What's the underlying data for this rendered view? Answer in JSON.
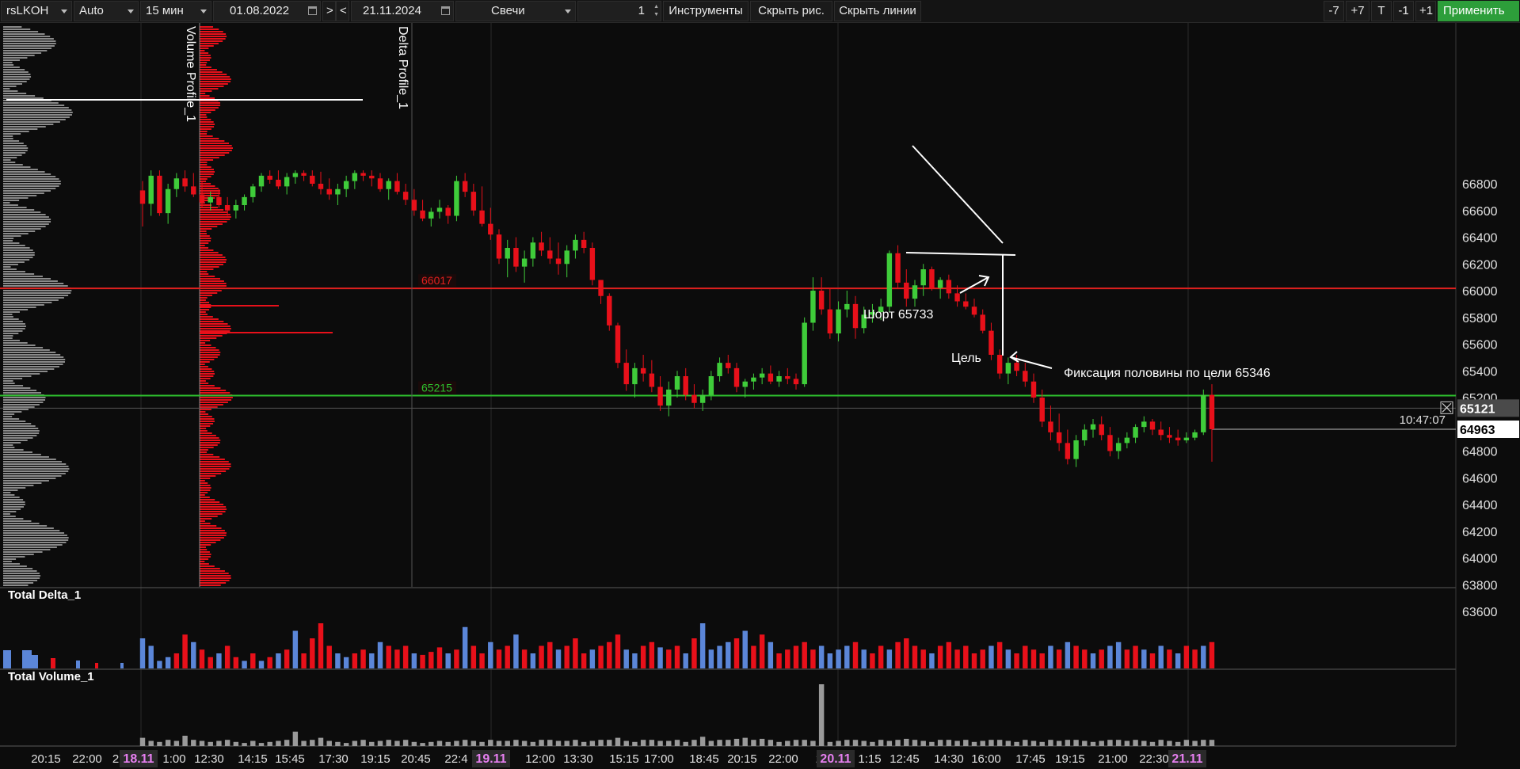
{
  "toolbar": {
    "symbol": "rsLKOH",
    "scale": "Auto",
    "timeframe": "15 мин",
    "date_from": "01.08.2022",
    "nav_next": ">",
    "nav_prev": "<",
    "date_to": "21.11.2024",
    "chart_type": "Свечи",
    "count": "1",
    "instruments": "Инструменты",
    "hide_drawings": "Скрыть рис.",
    "hide_lines": "Скрыть линии",
    "minus7": "-7",
    "plus7": "+7",
    "t": "T",
    "minus1": "-1",
    "plus1": "+1",
    "apply": "Применить"
  },
  "colors": {
    "up": "#3fcc3a",
    "down": "#e8101a",
    "delta_pos": "#5b86d8",
    "delta_neg": "#e8101a",
    "volume": "#9a9a9a",
    "level_red": "#e0201e",
    "level_green": "#2ec02e",
    "accent_date": "#e67ff0",
    "apply": "#2d9e3a"
  },
  "chart_data": {
    "type": "candlestick",
    "symbol": "rsLKOH",
    "price_axis": {
      "min": 63500,
      "max": 66900,
      "ticks": [
        63600,
        63800,
        64000,
        64200,
        64400,
        64600,
        64800,
        65000,
        65200,
        65400,
        65600,
        65800,
        66000,
        66200,
        66400,
        66600,
        66800
      ]
    },
    "levels": [
      {
        "price": 66017,
        "label": "66017",
        "color": "#e0201e"
      },
      {
        "price": 65215,
        "label": "65215",
        "color": "#2ec02e"
      }
    ],
    "crosshair": {
      "price": 65121,
      "label": "65121"
    },
    "last_price": {
      "price": 64963,
      "label": "64963",
      "time": "10:47:07"
    },
    "time_labels": [
      {
        "text": "20:15"
      },
      {
        "text": "22:00"
      },
      {
        "text": "2"
      },
      {
        "text": "18.11",
        "day": true
      },
      {
        "text": "1:00"
      },
      {
        "text": "12:30"
      },
      {
        "text": "14:15"
      },
      {
        "text": "15:45"
      },
      {
        "text": "17:30"
      },
      {
        "text": "19:15"
      },
      {
        "text": "20:45"
      },
      {
        "text": "22:4"
      },
      {
        "text": "19.11",
        "day": true
      },
      {
        "text": "12:00"
      },
      {
        "text": "13:30"
      },
      {
        "text": "15:15"
      },
      {
        "text": "17:00"
      },
      {
        "text": "18:45"
      },
      {
        "text": "20:15"
      },
      {
        "text": "22:00"
      },
      {
        "text": "2"
      },
      {
        "text": "20.11",
        "day": true
      },
      {
        "text": "1:15"
      },
      {
        "text": "12:45"
      },
      {
        "text": "14:30"
      },
      {
        "text": "16:00"
      },
      {
        "text": "17:45"
      },
      {
        "text": "19:15"
      },
      {
        "text": "21:00"
      },
      {
        "text": "22:30"
      },
      {
        "text": "21.11",
        "day": true
      }
    ],
    "candles": [
      [
        66750,
        66820,
        66480,
        66650
      ],
      [
        66650,
        66900,
        66560,
        66860
      ],
      [
        66860,
        66900,
        66560,
        66580
      ],
      [
        66580,
        66800,
        66500,
        66760
      ],
      [
        66760,
        66880,
        66700,
        66840
      ],
      [
        66840,
        66900,
        66740,
        66780
      ],
      [
        66780,
        66880,
        66700,
        66720
      ],
      [
        66720,
        66820,
        66620,
        66660
      ],
      [
        66660,
        66740,
        66600,
        66700
      ],
      [
        66700,
        66760,
        66620,
        66640
      ],
      [
        66640,
        66700,
        66560,
        66600
      ],
      [
        66600,
        66680,
        66540,
        66640
      ],
      [
        66640,
        66720,
        66600,
        66700
      ],
      [
        66700,
        66800,
        66660,
        66780
      ],
      [
        66780,
        66880,
        66740,
        66860
      ],
      [
        66860,
        66900,
        66800,
        66830
      ],
      [
        66830,
        66900,
        66760,
        66780
      ],
      [
        66780,
        66880,
        66720,
        66850
      ],
      [
        66850,
        66900,
        66800,
        66880
      ],
      [
        66880,
        66900,
        66820,
        66860
      ],
      [
        66860,
        66900,
        66780,
        66800
      ],
      [
        66800,
        66890,
        66720,
        66760
      ],
      [
        66760,
        66840,
        66680,
        66720
      ],
      [
        66720,
        66800,
        66640,
        66760
      ],
      [
        66760,
        66860,
        66700,
        66820
      ],
      [
        66820,
        66900,
        66760,
        66880
      ],
      [
        66880,
        66900,
        66820,
        66860
      ],
      [
        66860,
        66900,
        66780,
        66840
      ],
      [
        66840,
        66880,
        66740,
        66760
      ],
      [
        66760,
        66840,
        66680,
        66820
      ],
      [
        66820,
        66880,
        66720,
        66740
      ],
      [
        66740,
        66800,
        66640,
        66680
      ],
      [
        66680,
        66760,
        66560,
        66600
      ],
      [
        66600,
        66680,
        66520,
        66540
      ],
      [
        66540,
        66620,
        66480,
        66590
      ],
      [
        66590,
        66680,
        66540,
        66620
      ],
      [
        66620,
        66640,
        66500,
        66560
      ],
      [
        66560,
        66860,
        66520,
        66820
      ],
      [
        66820,
        66880,
        66700,
        66740
      ],
      [
        66740,
        66800,
        66560,
        66600
      ],
      [
        66600,
        66780,
        66480,
        66500
      ],
      [
        66500,
        66620,
        66380,
        66420
      ],
      [
        66420,
        66460,
        66200,
        66240
      ],
      [
        66240,
        66380,
        66100,
        66320
      ],
      [
        66320,
        66400,
        66140,
        66180
      ],
      [
        66180,
        66300,
        66060,
        66240
      ],
      [
        66240,
        66400,
        66180,
        66360
      ],
      [
        66360,
        66440,
        66260,
        66300
      ],
      [
        66300,
        66400,
        66200,
        66240
      ],
      [
        66240,
        66360,
        66120,
        66200
      ],
      [
        66200,
        66340,
        66100,
        66300
      ],
      [
        66300,
        66420,
        66240,
        66380
      ],
      [
        66380,
        66440,
        66280,
        66320
      ],
      [
        66320,
        66360,
        66040,
        66080
      ],
      [
        66080,
        66020,
        65900,
        65960
      ],
      [
        65960,
        65980,
        65700,
        65740
      ],
      [
        65740,
        65760,
        65420,
        65460
      ],
      [
        65460,
        65560,
        65250,
        65300
      ],
      [
        65300,
        65460,
        65200,
        65420
      ],
      [
        65420,
        65520,
        65320,
        65380
      ],
      [
        65380,
        65480,
        65240,
        65280
      ],
      [
        65280,
        65360,
        65100,
        65140
      ],
      [
        65140,
        65320,
        65060,
        65260
      ],
      [
        65260,
        65400,
        65200,
        65360
      ],
      [
        65360,
        65420,
        65180,
        65220
      ],
      [
        65220,
        65300,
        65120,
        65160
      ],
      [
        65160,
        65260,
        65100,
        65220
      ],
      [
        65220,
        65400,
        65180,
        65360
      ],
      [
        65360,
        65500,
        65320,
        65460
      ],
      [
        65460,
        65520,
        65380,
        65420
      ],
      [
        65420,
        65460,
        65240,
        65280
      ],
      [
        65280,
        65340,
        65200,
        65320
      ],
      [
        65320,
        65380,
        65260,
        65350
      ],
      [
        65350,
        65420,
        65300,
        65380
      ],
      [
        65380,
        65440,
        65300,
        65320
      ],
      [
        65320,
        65400,
        65280,
        65360
      ],
      [
        65360,
        65420,
        65300,
        65340
      ],
      [
        65340,
        65380,
        65260,
        65300
      ],
      [
        65300,
        65800,
        65280,
        65760
      ],
      [
        65760,
        66100,
        65700,
        66000
      ],
      [
        66000,
        66100,
        65820,
        65860
      ],
      [
        65860,
        66020,
        65640,
        65680
      ],
      [
        65680,
        65920,
        65620,
        65860
      ],
      [
        65860,
        66000,
        65800,
        65900
      ],
      [
        65900,
        65960,
        65640,
        65720
      ],
      [
        65720,
        65880,
        65680,
        65820
      ],
      [
        65820,
        65900,
        65760,
        65840
      ],
      [
        65840,
        65940,
        65780,
        65880
      ],
      [
        65880,
        66300,
        65840,
        66280
      ],
      [
        66280,
        66340,
        66020,
        66060
      ],
      [
        66060,
        66160,
        65880,
        65940
      ],
      [
        65940,
        66080,
        65880,
        66040
      ],
      [
        66040,
        66200,
        65960,
        66160
      ],
      [
        66160,
        66180,
        66000,
        66020
      ],
      [
        66020,
        66100,
        65940,
        66080
      ],
      [
        66080,
        66120,
        65940,
        65980
      ],
      [
        65980,
        66040,
        65880,
        65920
      ],
      [
        65920,
        65980,
        65860,
        65880
      ],
      [
        65880,
        65940,
        65800,
        65820
      ],
      [
        65820,
        65860,
        65680,
        65700
      ],
      [
        65700,
        65760,
        65480,
        65520
      ],
      [
        65520,
        65560,
        65340,
        65380
      ],
      [
        65380,
        65500,
        65300,
        65460
      ],
      [
        65460,
        65520,
        65360,
        65400
      ],
      [
        65400,
        65460,
        65280,
        65320
      ],
      [
        65320,
        65380,
        65160,
        65200
      ],
      [
        65200,
        65260,
        64980,
        65020
      ],
      [
        65020,
        65140,
        64880,
        64940
      ],
      [
        64940,
        65080,
        64800,
        64860
      ],
      [
        64860,
        64960,
        64700,
        64740
      ],
      [
        64740,
        64920,
        64680,
        64880
      ],
      [
        64880,
        65000,
        64840,
        64960
      ],
      [
        64960,
        65040,
        64900,
        65000
      ],
      [
        65000,
        65060,
        64880,
        64920
      ],
      [
        64920,
        64980,
        64760,
        64800
      ],
      [
        64800,
        64900,
        64740,
        64860
      ],
      [
        64860,
        64940,
        64820,
        64900
      ],
      [
        64900,
        65000,
        64860,
        64980
      ],
      [
        64980,
        65060,
        64940,
        65020
      ],
      [
        65020,
        65040,
        64920,
        64960
      ],
      [
        64960,
        65020,
        64880,
        64920
      ],
      [
        64920,
        64980,
        64860,
        64900
      ],
      [
        64900,
        64960,
        64840,
        64880
      ],
      [
        64880,
        64940,
        64860,
        64900
      ],
      [
        64900,
        64960,
        64880,
        64940
      ],
      [
        64940,
        65260,
        64920,
        65220
      ],
      [
        65220,
        65300,
        64720,
        64963
      ]
    ],
    "annotations": [
      {
        "text": "Шорт 65733"
      },
      {
        "text": "Цель"
      },
      {
        "text": "Фиксация половины по цели 65346"
      }
    ],
    "indicators": [
      {
        "name": "Volume Profile_1"
      },
      {
        "name": "Delta Profile_1"
      },
      {
        "name": "Total Delta_1"
      },
      {
        "name": "Total Volume_1"
      }
    ],
    "delta": [
      40,
      30,
      10,
      15,
      20,
      45,
      35,
      25,
      15,
      20,
      30,
      15,
      10,
      20,
      10,
      15,
      20,
      25,
      50,
      20,
      40,
      60,
      30,
      20,
      15,
      20,
      25,
      20,
      35,
      30,
      25,
      30,
      20,
      18,
      22,
      28,
      20,
      25,
      55,
      30,
      20,
      35,
      25,
      30,
      45,
      25,
      20,
      30,
      35,
      25,
      30,
      40,
      20,
      25,
      30,
      35,
      45,
      25,
      20,
      30,
      35,
      28,
      25,
      30,
      20,
      40,
      60,
      25,
      30,
      35,
      40,
      50,
      30,
      45,
      35,
      20,
      25,
      30,
      35,
      25,
      30,
      20,
      25,
      30,
      35,
      25,
      20,
      30,
      25,
      35,
      40,
      30,
      25,
      20,
      30,
      35,
      25,
      30,
      20,
      25,
      30,
      35,
      25,
      20,
      30,
      25,
      20,
      30,
      25,
      35,
      30,
      25,
      20,
      25,
      30,
      35,
      25,
      30,
      25,
      20,
      30,
      25,
      20,
      30,
      25,
      30,
      35
    ],
    "delta_sign": [
      1,
      1,
      1,
      1,
      -1,
      -1,
      1,
      -1,
      -1,
      1,
      -1,
      -1,
      1,
      -1,
      1,
      -1,
      1,
      -1,
      1,
      -1,
      -1,
      -1,
      -1,
      1,
      1,
      -1,
      -1,
      1,
      1,
      -1,
      -1,
      -1,
      1,
      -1,
      -1,
      -1,
      1,
      -1,
      1,
      -1,
      -1,
      1,
      -1,
      -1,
      1,
      -1,
      1,
      -1,
      -1,
      1,
      -1,
      -1,
      -1,
      1,
      -1,
      -1,
      -1,
      1,
      1,
      -1,
      -1,
      1,
      -1,
      -1,
      1,
      -1,
      1,
      1,
      1,
      1,
      -1,
      1,
      -1,
      -1,
      1,
      -1,
      -1,
      -1,
      -1,
      -1,
      1,
      1,
      1,
      1,
      -1,
      1,
      -1,
      -1,
      1,
      -1,
      -1,
      -1,
      -1,
      1,
      -1,
      -1,
      -1,
      -1,
      -1,
      -1,
      1,
      -1,
      1,
      -1,
      -1,
      -1,
      -1,
      1,
      -1,
      1,
      -1,
      -1,
      1,
      -1,
      1,
      1,
      -1,
      -1,
      1,
      -1,
      1,
      -1,
      1,
      -1,
      -1,
      1,
      -1
    ],
    "volume": [
      8,
      5,
      4,
      6,
      5,
      10,
      6,
      5,
      4,
      5,
      6,
      4,
      3,
      5,
      3,
      4,
      5,
      6,
      14,
      5,
      6,
      8,
      5,
      4,
      3,
      5,
      6,
      4,
      5,
      6,
      5,
      6,
      4,
      3,
      4,
      5,
      4,
      5,
      6,
      5,
      4,
      6,
      5,
      5,
      6,
      5,
      4,
      6,
      6,
      5,
      5,
      6,
      4,
      5,
      6,
      6,
      8,
      5,
      4,
      6,
      6,
      5,
      5,
      6,
      4,
      6,
      9,
      5,
      6,
      6,
      7,
      8,
      6,
      7,
      6,
      4,
      5,
      6,
      6,
      5,
      60,
      4,
      5,
      6,
      6,
      5,
      4,
      6,
      5,
      6,
      7,
      6,
      5,
      4,
      6,
      6,
      5,
      6,
      4,
      5,
      6,
      6,
      5,
      4,
      6,
      5,
      4,
      6,
      5,
      6,
      6,
      5,
      4,
      5,
      6,
      6,
      5,
      6,
      5,
      4,
      6,
      5,
      4,
      6,
      5,
      6,
      6
    ]
  }
}
